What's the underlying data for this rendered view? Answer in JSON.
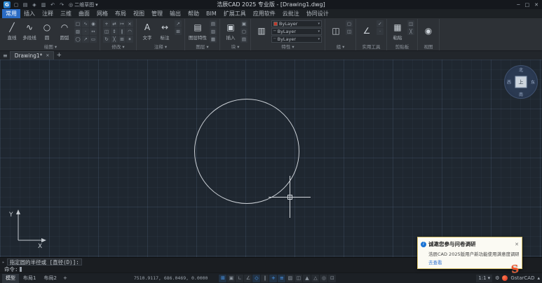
{
  "titlebar": {
    "app_title": "浩辰CAD 2025 专业版 - [Drawing1.dwg]",
    "workspace": "二维草图",
    "quick_access": [
      "new",
      "open",
      "save",
      "print",
      "undo",
      "redo"
    ],
    "window_controls": {
      "minimize": "─",
      "maximize": "□",
      "close": "✕"
    }
  },
  "ribbon": {
    "tabs": [
      {
        "id": "home",
        "label": "常用"
      },
      {
        "id": "insert",
        "label": "插入"
      },
      {
        "id": "annotate",
        "label": "注释"
      },
      {
        "id": "3d",
        "label": "三维"
      },
      {
        "id": "surface",
        "label": "曲面"
      },
      {
        "id": "mesh",
        "label": "网格"
      },
      {
        "id": "layout",
        "label": "布局"
      },
      {
        "id": "view",
        "label": "视图"
      },
      {
        "id": "manage",
        "label": "管理"
      },
      {
        "id": "output",
        "label": "输出"
      },
      {
        "id": "help",
        "label": "帮助"
      },
      {
        "id": "bim",
        "label": "BIM"
      },
      {
        "id": "express",
        "label": "扩展工具"
      },
      {
        "id": "apps",
        "label": "应用软件"
      },
      {
        "id": "cloud",
        "label": "云批注"
      },
      {
        "id": "collab",
        "label": "协同设计"
      }
    ],
    "active_tab": "home",
    "panels": [
      {
        "id": "draw",
        "label": "绘图",
        "flyout": true,
        "big": [
          {
            "label": "直线",
            "icon": "line"
          },
          {
            "label": "多段线",
            "icon": "polyline"
          },
          {
            "label": "圆",
            "icon": "circle"
          },
          {
            "label": "圆弧",
            "icon": "arc"
          }
        ],
        "small": [
          "rectangle",
          "hatch",
          "ellipse",
          "spline",
          "point",
          "ray",
          "donut",
          "construction-line",
          "region"
        ]
      },
      {
        "id": "modify",
        "label": "修改",
        "flyout": true,
        "big": [],
        "small": [
          "move",
          "copy",
          "rotate",
          "mirror",
          "stretch",
          "trim",
          "extend",
          "offset",
          "array",
          "erase",
          "fillet",
          "explode"
        ]
      },
      {
        "id": "annotation",
        "label": "注释",
        "flyout": true,
        "big": [
          {
            "label": "文字",
            "icon": "text"
          },
          {
            "label": "标注",
            "icon": "dimension"
          }
        ],
        "small": [
          "leader",
          "table"
        ]
      },
      {
        "id": "layers",
        "label": "图层",
        "flyout": true,
        "big": [
          {
            "label": "图层特性",
            "icon": "layers"
          }
        ],
        "small": [
          "layer-state",
          "layer-isolate",
          "layer-off"
        ]
      },
      {
        "id": "block",
        "label": "块",
        "flyout": true,
        "big": [
          {
            "label": "插入",
            "icon": "insert-block"
          }
        ],
        "small": [
          "create-block",
          "edit-block",
          "block-attribute"
        ]
      },
      {
        "id": "properties",
        "label": "特性",
        "flyout": true,
        "big": [
          {
            "label": "",
            "icon": "match-properties"
          }
        ],
        "dropdowns": [
          {
            "icon": "color-swatch",
            "value": "ByLayer"
          },
          {
            "icon": "lineweight-sample",
            "value": "ByLayer"
          },
          {
            "icon": "linetype",
            "value": "ByLayer"
          }
        ]
      },
      {
        "id": "group",
        "label": "组",
        "flyout": true,
        "big": [
          {
            "label": "",
            "icon": "group"
          }
        ],
        "small": [
          "ungroup",
          "group-edit"
        ]
      },
      {
        "id": "utilities",
        "label": "实用工具",
        "flyout": false,
        "big": [
          {
            "label": "",
            "icon": "measure"
          }
        ],
        "small": [
          "quick-select",
          "point-id"
        ]
      },
      {
        "id": "clipboard",
        "label": "剪贴板",
        "flyout": false,
        "big": [
          {
            "label": "粘贴",
            "icon": "paste"
          }
        ],
        "small": [
          "copy-clip",
          "cut-clip"
        ]
      },
      {
        "id": "viewpanel",
        "label": "视图",
        "flyout": false,
        "big": [
          {
            "label": "",
            "icon": "view"
          }
        ],
        "small": []
      }
    ]
  },
  "document_tabs": {
    "menu_icon": "≡",
    "tabs": [
      {
        "label": "Drawing1*",
        "close": "✕"
      }
    ],
    "add_button": "+"
  },
  "canvas": {
    "viewcube": {
      "north": "北",
      "south": "南",
      "east": "东",
      "west": "西",
      "center": "上"
    },
    "ucs": {
      "x_label": "X",
      "y_label": "Y"
    }
  },
  "command_line": {
    "history": "指定圆的半径或 [直径(D)]:",
    "prompt": "命令:"
  },
  "statusbar": {
    "layout_tabs": [
      {
        "id": "model",
        "label": "模型"
      },
      {
        "id": "layout1",
        "label": "布局1"
      },
      {
        "id": "layout2",
        "label": "布局2"
      }
    ],
    "active_layout_tab": "model",
    "add_layout": "+",
    "coordinates": "7510.9117, 686.0469, 0.0000",
    "toggles": [
      "grid",
      "snap",
      "ortho",
      "polar",
      "osnap",
      "otrack",
      "dynamic-input",
      "lineweight",
      "transparency",
      "selection-cycling",
      "annotation-visibility",
      "auto-scale",
      "isolate-objects",
      "clean-screen"
    ],
    "active_toggles": [
      "grid",
      "osnap",
      "dynamic-input",
      "lineweight"
    ],
    "scale": "1:1",
    "brand": "GstarCAD"
  },
  "notification": {
    "title": "诚邀您参与问卷调研",
    "body": "浩辰CAD 2025版用户新功能使用满意度调研",
    "link": "去查看",
    "close": "✕"
  },
  "colors": {
    "accent_blue": "#2a6bc4",
    "canvas_bg": "#1f2730",
    "logo_orange": "#f34e1f",
    "popup_link": "#2a6fd0"
  }
}
